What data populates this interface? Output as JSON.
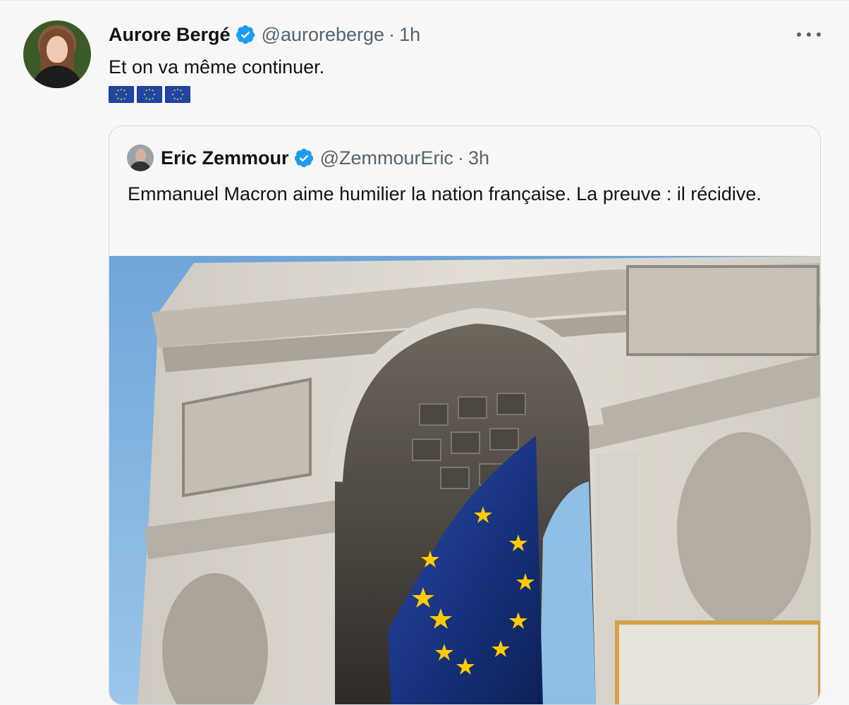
{
  "tweet": {
    "author_name": "Aurore Bergé",
    "author_handle": "@auroreberge",
    "separator": "·",
    "time": "1h",
    "text": "Et on va même continuer.",
    "emoji_flags": [
      "eu-flag-icon",
      "eu-flag-icon",
      "eu-flag-icon"
    ]
  },
  "quoted_tweet": {
    "author_name": "Eric Zemmour",
    "author_handle": "@ZemmourEric",
    "separator": "·",
    "time": "3h",
    "text": "Emmanuel Macron aime humilier la nation française. La preuve : il récidive.",
    "image_description_icon": "arc-de-triomphe-photo"
  },
  "colors": {
    "verified": "#1d9bf0",
    "secondary_text": "#536471",
    "eu_blue": "#1f46a6",
    "eu_star": "#ffcc00",
    "sky": "#7fb2de"
  }
}
